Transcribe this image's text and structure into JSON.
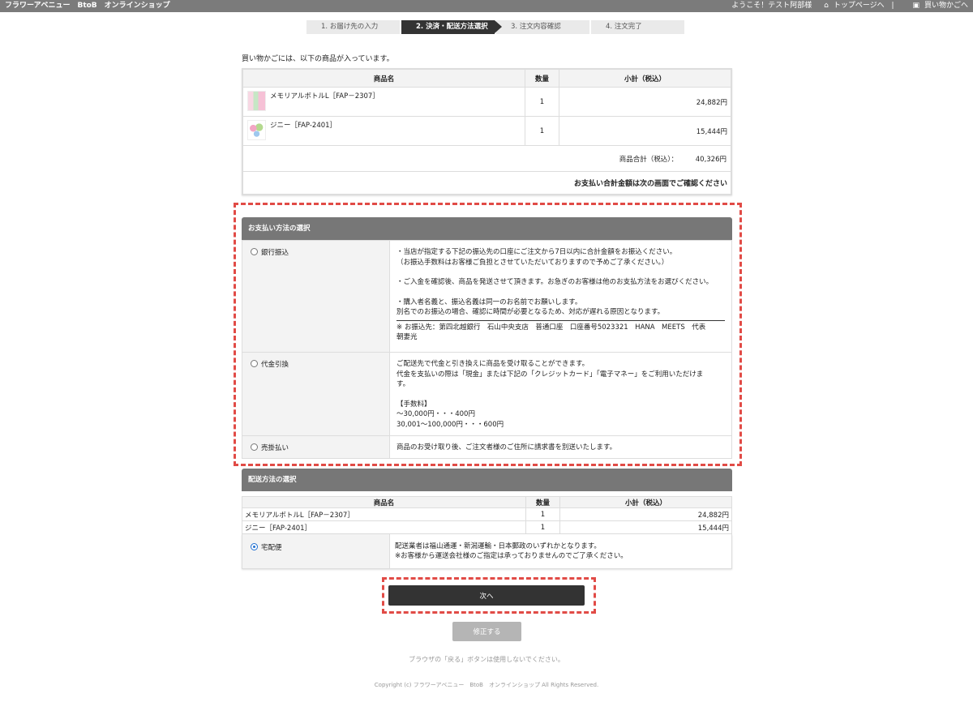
{
  "header": {
    "site_title": "フラワーアベニュー　BtoB　オンラインショップ",
    "welcome": "ようこそ！テスト阿部様",
    "top_link": "トップページへ",
    "separator": "|",
    "cart_link": "買い物かごへ",
    "bg_color": "#7b7b7b"
  },
  "steps": [
    {
      "label": "1.  お届け先の入力",
      "active": false
    },
    {
      "label": "2.  決済・配送方法選択",
      "active": true
    },
    {
      "label": "3.  注文内容確認",
      "active": false
    },
    {
      "label": "4.  注文完了",
      "active": false
    }
  ],
  "intro": "買い物かごには、以下の商品が入っています。",
  "cart": {
    "headers": {
      "name": "商品名",
      "qty": "数量",
      "subtotal": "小計（税込）"
    },
    "items": [
      {
        "name": "メモリアルボトルL［FAP－2307］",
        "qty": "1",
        "subtotal": "24,882円"
      },
      {
        "name": "ジニー［FAP-2401］",
        "qty": "1",
        "subtotal": "15,444円"
      }
    ],
    "total_label": "商品合計（税込）：",
    "total_value": "40,326円",
    "note": "お支払い合計金額は次の画面でご確認ください"
  },
  "payment": {
    "title": "お支払い方法の選択",
    "options": [
      {
        "label": "銀行振込",
        "checked": false,
        "lines": [
          "・当店が指定する下記の振込先の口座にご注文から7日以内に合計金額をお振込ください。",
          "（お振込手数料はお客様ご負担とさせていただいておりますので予めご了承ください。）",
          "",
          "・ご入金を確認後、商品を発送させて頂きます。お急ぎのお客様は他のお支払方法をお選びください。",
          "",
          "・購入者名義と、振込名義は同一のお名前でお願いします。",
          "別名でのお振込の場合、確認に時間が必要となるため、対応が遅れる原因となります。"
        ],
        "account_line1": "※ お振込先：第四北越銀行　石山中央支店　普通口座　口座番号5023321　HANA　MEETS　代表",
        "account_line2": "朝妻光"
      },
      {
        "label": "代金引換",
        "checked": false,
        "lines": [
          "ご配送先で代金と引き換えに商品を受け取ることができます。",
          "代金を支払いの際は「現金」または下記の「クレジットカード」「電子マネー」をご利用いただけま",
          "す。",
          "",
          "【手数料】",
          "〜30,000円・・・400円",
          "30,001〜100,000円・・・600円"
        ]
      },
      {
        "label": "売掛払い",
        "checked": false,
        "lines": [
          "商品のお受け取り後、ご注文者様のご住所に請求書を別送いたします。"
        ]
      }
    ]
  },
  "shipping": {
    "title": "配送方法の選択",
    "headers": {
      "name": "商品名",
      "qty": "数量",
      "subtotal": "小計（税込）"
    },
    "items": [
      {
        "name": "メモリアルボトルL［FAP－2307］",
        "qty": "1",
        "subtotal": "24,882円"
      },
      {
        "name": "ジニー［FAP-2401］",
        "qty": "1",
        "subtotal": "15,444円"
      }
    ],
    "method_label": "宅配便",
    "method_checked": true,
    "method_line1": "配送業者は福山通運・新潟運輸・日本郵政のいずれかとなります。",
    "method_line2": "※お客様から運送会社様のご指定は承っておりませんのでご了承ください。"
  },
  "buttons": {
    "next": "次へ",
    "fix": "修正する"
  },
  "footer": {
    "warning": "ブラウザの「戻る」ボタンは使用しないでください。",
    "copyright": "Copyright (c) フラワーアベニュー　BtoB　オンラインショップ All Rights Reserved."
  },
  "colors": {
    "highlight": "#e14b46",
    "radio_checked": "#1f6fd1",
    "dark_button": "#333333"
  }
}
